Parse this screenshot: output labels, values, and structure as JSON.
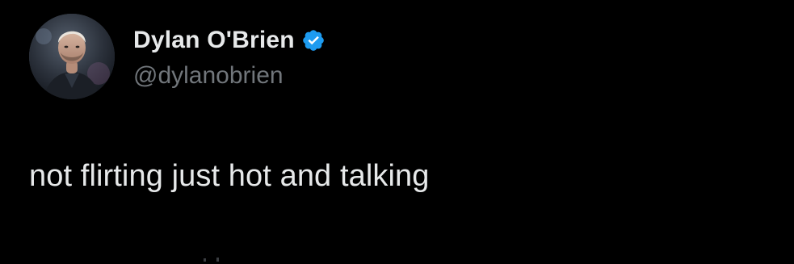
{
  "tweet": {
    "author": {
      "display_name": "Dylan O'Brien",
      "handle": "@dylanobrien",
      "verified": true,
      "avatar_icon": "profile-photo"
    },
    "text": "not flirting just hot and talking"
  },
  "colors": {
    "background": "#000000",
    "primary_text": "#e7e9ea",
    "secondary_text": "#71767b",
    "verified_badge": "#1d9bf0"
  }
}
